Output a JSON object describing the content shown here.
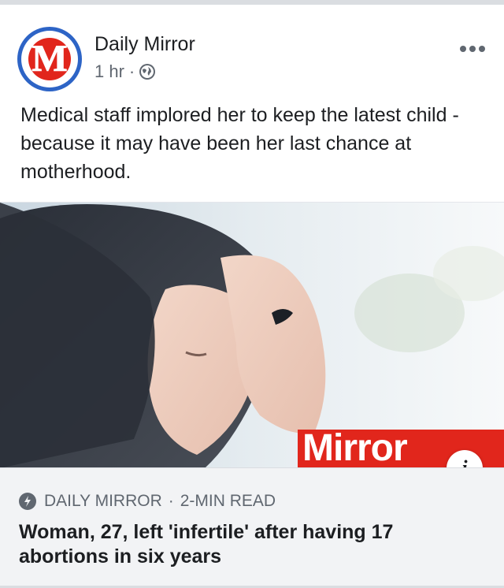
{
  "post": {
    "page_name": "Daily Mirror",
    "time": "1 hr",
    "dot": "·",
    "privacy_icon": "globe-icon",
    "more_icon": "more-options-icon",
    "avatar_letter": "M",
    "caption": "Medical staff implored her to keep the latest child - because it may have been her last chance at motherhood."
  },
  "link_preview": {
    "image_badge": "Mirror",
    "info_label": "i",
    "source_icon": "instant-article-bolt-icon",
    "source": "DAILY MIRROR",
    "separator": "·",
    "read_time": "2-MIN READ",
    "headline": "Woman, 27, left 'infertile' after having 17 abortions in six years"
  },
  "colors": {
    "brand_red": "#e1261c",
    "avatar_ring": "#2d64c6",
    "text_primary": "#1c1e21",
    "text_secondary": "#606770",
    "link_bg": "#f2f3f5"
  }
}
